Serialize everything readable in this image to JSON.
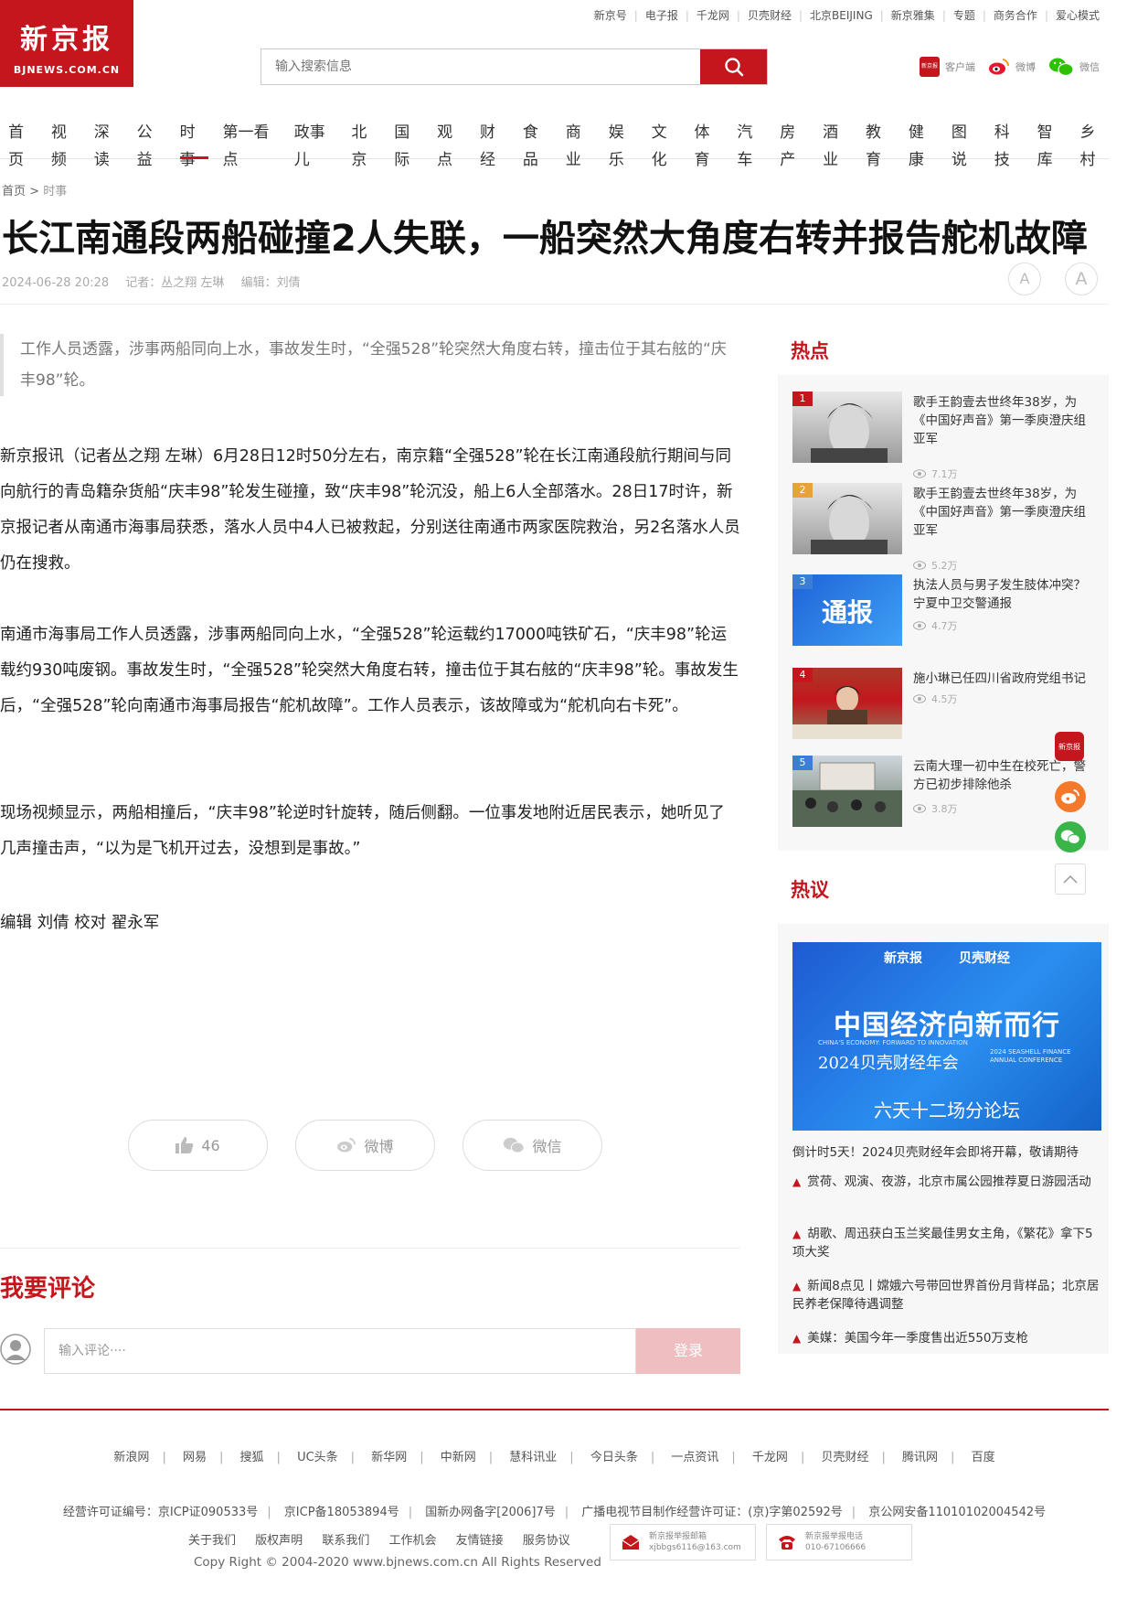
{
  "logo": {
    "cn": "新京报",
    "en": "BJNEWS.COM.CN"
  },
  "topnav": [
    "新京号",
    "电子报",
    "千龙网",
    "贝壳财经",
    "北京BEIJING",
    "新京雅集",
    "专题",
    "商务合作",
    "爱心模式"
  ],
  "search": {
    "placeholder": "输入搜索信息"
  },
  "apps": {
    "client": "客户端",
    "client_badge": "新京报",
    "weibo": "微博",
    "wechat": "微信"
  },
  "mainnav": [
    "首页",
    "视频",
    "深读",
    "公益",
    "时事",
    "第一看点",
    "政事儿",
    "北京",
    "国际",
    "观点",
    "财经",
    "食品",
    "商业",
    "娱乐",
    "文化",
    "体育",
    "汽车",
    "房产",
    "酒业",
    "教育",
    "健康",
    "图说",
    "科技",
    "智库",
    "乡村"
  ],
  "active_nav": "时事",
  "breadcrumb": {
    "home": "首页",
    "sep": ">",
    "current": "时事"
  },
  "article": {
    "title": "长江南通段两船碰撞2人失联，一船突然大角度右转并报告舵机故障",
    "time": "2024-06-28 20:28",
    "reporter": "记者：丛之翔 左琳",
    "editor": "编辑：刘倩",
    "summary": "工作人员透露，涉事两船同向上水，事故发生时，“全强528”轮突然大角度右转，撞击位于其右舷的“庆丰98”轮。",
    "paragraphs": [
      "新京报讯（记者丛之翔 左琳）6月28日12时50分左右，南京籍“全强528”轮在长江南通段航行期间与同向航行的青岛籍杂货船“庆丰98”轮发生碰撞，致“庆丰98”轮沉没，船上6人全部落水。28日17时许，新京报记者从南通市海事局获悉，落水人员中4人已被救起，分别送往南通市两家医院救治，另2名落水人员仍在搜救。",
      "南通市海事局工作人员透露，涉事两船同向上水，“全强528”轮运载约17000吨铁矿石，“庆丰98”轮运载约930吨废钢。事故发生时，“全强528”轮突然大角度右转，撞击位于其右舷的“庆丰98”轮。事故发生后，“全强528”轮向南通市海事局报告“舵机故障”。工作人员表示，该故障或为“舵机向右卡死”。",
      "现场视频显示，两船相撞后，“庆丰98”轮逆时针旋转，随后侧翻。一位事发地附近居民表示，她听见了几声撞击声，“以为是飞机开过去，没想到是事故。”",
      "编辑 刘倩 校对 翟永军"
    ],
    "font_btn_small": "A",
    "font_btn_large": "A"
  },
  "actions": {
    "like_count": "46",
    "weibo": "微博",
    "wechat": "微信"
  },
  "comment": {
    "title": "我要评论",
    "placeholder": "输入评论····",
    "button": "登录"
  },
  "sidebar": {
    "hot_title": "热点",
    "hot": [
      {
        "rank": "1",
        "text": "歌手王韵壹去世终年38岁，为《中国好声音》第一季庾澄庆组亚军",
        "views": "7.1万"
      },
      {
        "rank": "2",
        "text": "歌手王韵壹去世终年38岁，为《中国好声音》第一季庾澄庆组亚军",
        "views": "5.2万"
      },
      {
        "rank": "3",
        "text": "执法人员与男子发生肢体冲突？宁夏中卫交警通报",
        "views": "4.7万",
        "img_text": "通报"
      },
      {
        "rank": "4",
        "text": "施小琳已任四川省政府党组书记",
        "views": "4.5万"
      },
      {
        "rank": "5",
        "text": "云南大理一初中生在校死亡，警方已初步排除他杀",
        "views": "3.8万"
      }
    ],
    "debate_title": "热议",
    "promo": {
      "top_left": "新京报",
      "top_right": "贝壳财经",
      "main": "中国经济向新而行",
      "en": "CHINA'S ECONOMY: FORWARD TO INNOVATION",
      "sub": "2024贝壳财经年会",
      "en2": "2024 SEASHELL FINANCE ANNUAL CONFERENCE",
      "bottom": "六天十二场分论坛"
    },
    "promo_caption": "倒计时5天！2024贝壳财经年会即将开幕，敬请期待",
    "debate": [
      "赏荷、观演、夜游，北京市属公园推荐夏日游园活动",
      "胡歌、周迅获白玉兰奖最佳男女主角，《繁花》拿下5项大奖",
      "新闻8点见丨嫦娥六号带回世界首份月背样品；北京居民养老保障待遇调整",
      "美媒：美国今年一季度售出近550万支枪"
    ],
    "float_badge": "新京报"
  },
  "footer": {
    "links": [
      "新浪网",
      "网易",
      "搜狐",
      "UC头条",
      "新华网",
      "中新网",
      "慧科讯业",
      "今日头条",
      "一点资讯",
      "千龙网",
      "贝壳财经",
      "腾讯网",
      "百度"
    ],
    "licenses": [
      "经营许可证编号：京ICP证090533号",
      "京ICP备18053894号",
      "国新办网备字[2006]7号",
      "广播电视节目制作经营许可证：(京)字第02592号",
      "京公网安备11010102004542号"
    ],
    "small": [
      "关于我们",
      "版权声明",
      "联系我们",
      "工作机会",
      "友情链接",
      "服务协议"
    ],
    "copyright": "Copy Right © 2004-2020 www.bjnews.com.cn All Rights Reserved",
    "report_mail_title": "新京报举报邮箱",
    "report_mail": "xjbbgs6116@163.com",
    "report_phone_title": "新京报举报电话",
    "report_phone": "010-67106666"
  },
  "colors": {
    "brand": "#c4161c",
    "muted": "#999999"
  }
}
